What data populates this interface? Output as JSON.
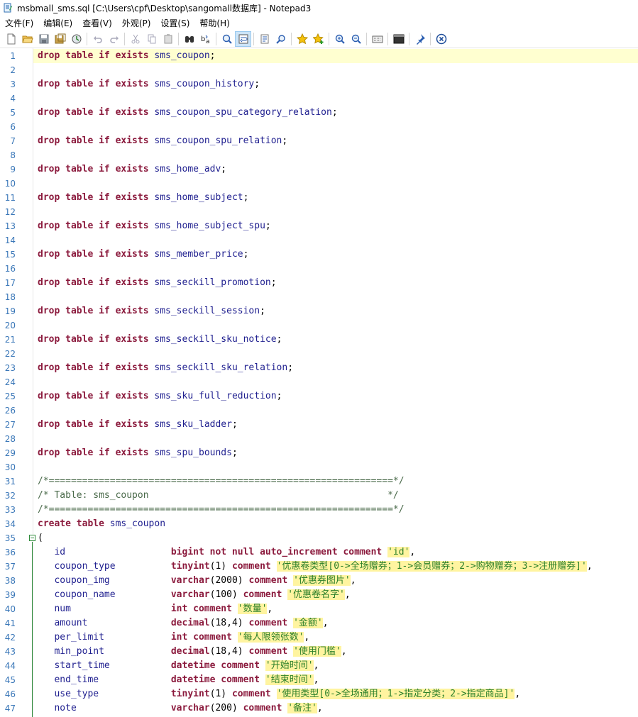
{
  "window": {
    "title": "msbmall_sms.sql [C:\\Users\\cpf\\Desktop\\sangomall数据库] - Notepad3"
  },
  "menu": [
    "文件(F)",
    "编辑(E)",
    "查看(V)",
    "外观(P)",
    "设置(S)",
    "帮助(H)"
  ],
  "toolbar": {
    "buttons": [
      "new-file",
      "open",
      "save",
      "save-all",
      "revert",
      "sep",
      "undo",
      "redo",
      "sep",
      "cut",
      "copy",
      "paste",
      "sep",
      "find",
      "replace",
      "sep",
      "zoom-search",
      "word-wrap",
      "sep",
      "goto",
      "find-next",
      "sep",
      "favorites",
      "add-favorite",
      "sep",
      "zoom-in",
      "zoom-out",
      "sep",
      "view-whitespace",
      "sep",
      "terminal",
      "sep",
      "pin",
      "sep",
      "close"
    ]
  },
  "colors": {
    "keyword": "#8b1a3d",
    "identifier": "#1f1f8f",
    "string": "#2a7f2a",
    "string_bg": "#fff4a0",
    "current_line": "#ffffd0",
    "line_number": "#3a77b8"
  },
  "editor": {
    "lines": [
      {
        "n": "1",
        "segs": [
          [
            "kw",
            "drop table if exists "
          ],
          [
            "id",
            "sms_coupon"
          ],
          [
            "pun",
            ";"
          ]
        ]
      },
      {
        "n": "2",
        "segs": []
      },
      {
        "n": "3",
        "segs": [
          [
            "kw",
            "drop table if exists "
          ],
          [
            "id",
            "sms_coupon_history"
          ],
          [
            "pun",
            ";"
          ]
        ]
      },
      {
        "n": "4",
        "segs": []
      },
      {
        "n": "5",
        "segs": [
          [
            "kw",
            "drop table if exists "
          ],
          [
            "id",
            "sms_coupon_spu_category_relation"
          ],
          [
            "pun",
            ";"
          ]
        ]
      },
      {
        "n": "6",
        "segs": []
      },
      {
        "n": "7",
        "segs": [
          [
            "kw",
            "drop table if exists "
          ],
          [
            "id",
            "sms_coupon_spu_relation"
          ],
          [
            "pun",
            ";"
          ]
        ]
      },
      {
        "n": "8",
        "segs": []
      },
      {
        "n": "9",
        "segs": [
          [
            "kw",
            "drop table if exists "
          ],
          [
            "id",
            "sms_home_adv"
          ],
          [
            "pun",
            ";"
          ]
        ]
      },
      {
        "n": "10",
        "segs": []
      },
      {
        "n": "11",
        "segs": [
          [
            "kw",
            "drop table if exists "
          ],
          [
            "id",
            "sms_home_subject"
          ],
          [
            "pun",
            ";"
          ]
        ]
      },
      {
        "n": "12",
        "segs": []
      },
      {
        "n": "13",
        "segs": [
          [
            "kw",
            "drop table if exists "
          ],
          [
            "id",
            "sms_home_subject_spu"
          ],
          [
            "pun",
            ";"
          ]
        ]
      },
      {
        "n": "14",
        "segs": []
      },
      {
        "n": "15",
        "segs": [
          [
            "kw",
            "drop table if exists "
          ],
          [
            "id",
            "sms_member_price"
          ],
          [
            "pun",
            ";"
          ]
        ]
      },
      {
        "n": "16",
        "segs": []
      },
      {
        "n": "17",
        "segs": [
          [
            "kw",
            "drop table if exists "
          ],
          [
            "id",
            "sms_seckill_promotion"
          ],
          [
            "pun",
            ";"
          ]
        ]
      },
      {
        "n": "18",
        "segs": []
      },
      {
        "n": "19",
        "segs": [
          [
            "kw",
            "drop table if exists "
          ],
          [
            "id",
            "sms_seckill_session"
          ],
          [
            "pun",
            ";"
          ]
        ]
      },
      {
        "n": "20",
        "segs": []
      },
      {
        "n": "21",
        "segs": [
          [
            "kw",
            "drop table if exists "
          ],
          [
            "id",
            "sms_seckill_sku_notice"
          ],
          [
            "pun",
            ";"
          ]
        ]
      },
      {
        "n": "22",
        "segs": []
      },
      {
        "n": "23",
        "segs": [
          [
            "kw",
            "drop table if exists "
          ],
          [
            "id",
            "sms_seckill_sku_relation"
          ],
          [
            "pun",
            ";"
          ]
        ]
      },
      {
        "n": "24",
        "segs": []
      },
      {
        "n": "25",
        "segs": [
          [
            "kw",
            "drop table if exists "
          ],
          [
            "id",
            "sms_sku_full_reduction"
          ],
          [
            "pun",
            ";"
          ]
        ]
      },
      {
        "n": "26",
        "segs": []
      },
      {
        "n": "27",
        "segs": [
          [
            "kw",
            "drop table if exists "
          ],
          [
            "id",
            "sms_sku_ladder"
          ],
          [
            "pun",
            ";"
          ]
        ]
      },
      {
        "n": "28",
        "segs": []
      },
      {
        "n": "29",
        "segs": [
          [
            "kw",
            "drop table if exists "
          ],
          [
            "id",
            "sms_spu_bounds"
          ],
          [
            "pun",
            ";"
          ]
        ]
      },
      {
        "n": "30",
        "segs": []
      },
      {
        "n": "31",
        "segs": [
          [
            "cm",
            "/*==============================================================*/"
          ]
        ]
      },
      {
        "n": "32",
        "segs": [
          [
            "cm",
            "/* Table: sms_coupon                                           */"
          ]
        ]
      },
      {
        "n": "33",
        "segs": [
          [
            "cm",
            "/*==============================================================*/"
          ]
        ]
      },
      {
        "n": "34",
        "segs": [
          [
            "kw",
            "create table "
          ],
          [
            "id",
            "sms_coupon"
          ]
        ]
      },
      {
        "n": "35",
        "segs": [
          [
            "pun",
            "("
          ]
        ]
      },
      {
        "n": "36",
        "segs": [
          [
            "id",
            "   id                   "
          ],
          [
            "kw",
            "bigint not null auto_increment comment "
          ],
          [
            "str",
            "'id'"
          ],
          [
            "pun",
            ","
          ]
        ]
      },
      {
        "n": "37",
        "segs": [
          [
            "id",
            "   coupon_type          "
          ],
          [
            "kw",
            "tinyint"
          ],
          [
            "pun",
            "(1) "
          ],
          [
            "kw",
            "comment "
          ],
          [
            "str",
            "'优惠卷类型[0->全场赠券；1->会员赠券；2->购物赠券；3->注册赠券]'"
          ],
          [
            "pun",
            ","
          ]
        ]
      },
      {
        "n": "38",
        "segs": [
          [
            "id",
            "   coupon_img           "
          ],
          [
            "kw",
            "varchar"
          ],
          [
            "pun",
            "(2000) "
          ],
          [
            "kw",
            "comment "
          ],
          [
            "str",
            "'优惠券图片'"
          ],
          [
            "pun",
            ","
          ]
        ]
      },
      {
        "n": "39",
        "segs": [
          [
            "id",
            "   coupon_name          "
          ],
          [
            "kw",
            "varchar"
          ],
          [
            "pun",
            "(100) "
          ],
          [
            "kw",
            "comment "
          ],
          [
            "str",
            "'优惠卷名字'"
          ],
          [
            "pun",
            ","
          ]
        ]
      },
      {
        "n": "40",
        "segs": [
          [
            "id",
            "   num                  "
          ],
          [
            "kw",
            "int comment "
          ],
          [
            "str",
            "'数量'"
          ],
          [
            "pun",
            ","
          ]
        ]
      },
      {
        "n": "41",
        "segs": [
          [
            "id",
            "   amount               "
          ],
          [
            "kw",
            "decimal"
          ],
          [
            "pun",
            "(18,4) "
          ],
          [
            "kw",
            "comment "
          ],
          [
            "str",
            "'金额'"
          ],
          [
            "pun",
            ","
          ]
        ]
      },
      {
        "n": "42",
        "segs": [
          [
            "id",
            "   per_limit            "
          ],
          [
            "kw",
            "int comment "
          ],
          [
            "str",
            "'每人限领张数'"
          ],
          [
            "pun",
            ","
          ]
        ]
      },
      {
        "n": "43",
        "segs": [
          [
            "id",
            "   min_point            "
          ],
          [
            "kw",
            "decimal"
          ],
          [
            "pun",
            "(18,4) "
          ],
          [
            "kw",
            "comment "
          ],
          [
            "str",
            "'使用门槛'"
          ],
          [
            "pun",
            ","
          ]
        ]
      },
      {
        "n": "44",
        "segs": [
          [
            "id",
            "   start_time           "
          ],
          [
            "kw",
            "datetime comment "
          ],
          [
            "str",
            "'开始时间'"
          ],
          [
            "pun",
            ","
          ]
        ]
      },
      {
        "n": "45",
        "segs": [
          [
            "id",
            "   end_time             "
          ],
          [
            "kw",
            "datetime comment "
          ],
          [
            "str",
            "'结束时间'"
          ],
          [
            "pun",
            ","
          ]
        ]
      },
      {
        "n": "46",
        "segs": [
          [
            "id",
            "   use_type             "
          ],
          [
            "kw",
            "tinyint"
          ],
          [
            "pun",
            "(1) "
          ],
          [
            "kw",
            "comment "
          ],
          [
            "str",
            "'使用类型[0->全场通用；1->指定分类；2->指定商品]'"
          ],
          [
            "pun",
            ","
          ]
        ]
      },
      {
        "n": "47",
        "segs": [
          [
            "id",
            "   note                 "
          ],
          [
            "kw",
            "varchar"
          ],
          [
            "pun",
            "(200) "
          ],
          [
            "kw",
            "comment "
          ],
          [
            "str",
            "'备注'"
          ],
          [
            "pun",
            ","
          ]
        ]
      }
    ]
  }
}
